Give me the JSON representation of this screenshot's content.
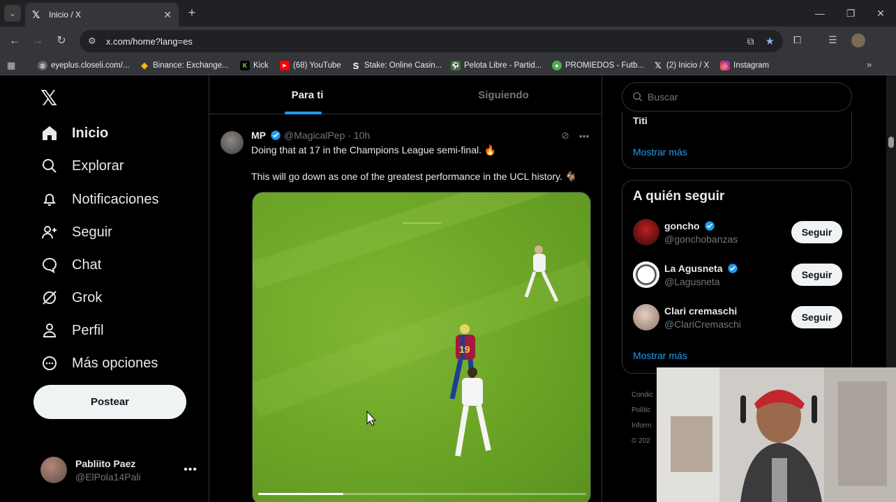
{
  "browser": {
    "tab_title": "Inicio / X",
    "url": "x.com/home?lang=es",
    "bookmarks": [
      {
        "label": "eyeplus.closeli.com/...",
        "icon": "globe-icon",
        "color": "#5f6368"
      },
      {
        "label": "Binance: Exchange...",
        "icon": "binance-icon",
        "color": "#f0b90b"
      },
      {
        "label": "Kick",
        "icon": "kick-icon",
        "color": "#53fc18"
      },
      {
        "label": "(68) YouTube",
        "icon": "youtube-icon",
        "color": "#ff0000"
      },
      {
        "label": "Stake: Online Casin...",
        "icon": "stake-icon",
        "color": "#1a2c38"
      },
      {
        "label": "Pelota Libre - Partid...",
        "icon": "ball-icon",
        "color": "#2e7d32"
      },
      {
        "label": "PROMIEDOS - Futb...",
        "icon": "promiedos-icon",
        "color": "#4caf50"
      },
      {
        "label": "(2) Inicio / X",
        "icon": "x-icon",
        "color": "#000000"
      },
      {
        "label": "Instagram",
        "icon": "instagram-icon",
        "color": "#e1306c"
      }
    ]
  },
  "nav": {
    "items": [
      {
        "label": "Inicio",
        "icon": "home-icon",
        "active": true
      },
      {
        "label": "Explorar",
        "icon": "search-icon"
      },
      {
        "label": "Notificaciones",
        "icon": "bell-icon"
      },
      {
        "label": "Seguir",
        "icon": "add-person-icon"
      },
      {
        "label": "Chat",
        "icon": "chat-icon"
      },
      {
        "label": "Grok",
        "icon": "grok-icon"
      },
      {
        "label": "Perfil",
        "icon": "person-icon"
      },
      {
        "label": "Más opciones",
        "icon": "more-circle-icon"
      }
    ],
    "post_button": "Postear",
    "account": {
      "name": "Pabliito Paez",
      "handle": "@ElPola14Pali"
    }
  },
  "feed": {
    "tabs": [
      {
        "label": "Para ti",
        "active": true
      },
      {
        "label": "Siguiendo",
        "active": false
      }
    ],
    "post": {
      "name": "MP",
      "handle": "@MagicalPep · 10h",
      "text1": "Doing that at 17 in the Champions League semi-final. 🔥",
      "text2": "This will go down as one of the greatest performance in the UCL history. 🐐",
      "video_progress": 0.26
    }
  },
  "sidebar": {
    "search_placeholder": "Buscar",
    "trend_last": "Titi",
    "show_more": "Mostrar más",
    "follow_title": "A quién seguir",
    "follow_button": "Seguir",
    "suggestions": [
      {
        "name": "goncho",
        "handle": "@gonchobanzas",
        "verified": true
      },
      {
        "name": "La Agusneta",
        "handle": "@Lagusneta",
        "verified": true
      },
      {
        "name": "Clari cremaschi",
        "handle": "@ClariCremaschi",
        "verified": false
      }
    ],
    "footer": [
      "Condic",
      "Polític",
      "Inform",
      "© 202"
    ]
  },
  "colors": {
    "accent": "#1d9bf0",
    "text": "#e7e9ea",
    "muted": "#71767b",
    "border": "#2f3336"
  }
}
